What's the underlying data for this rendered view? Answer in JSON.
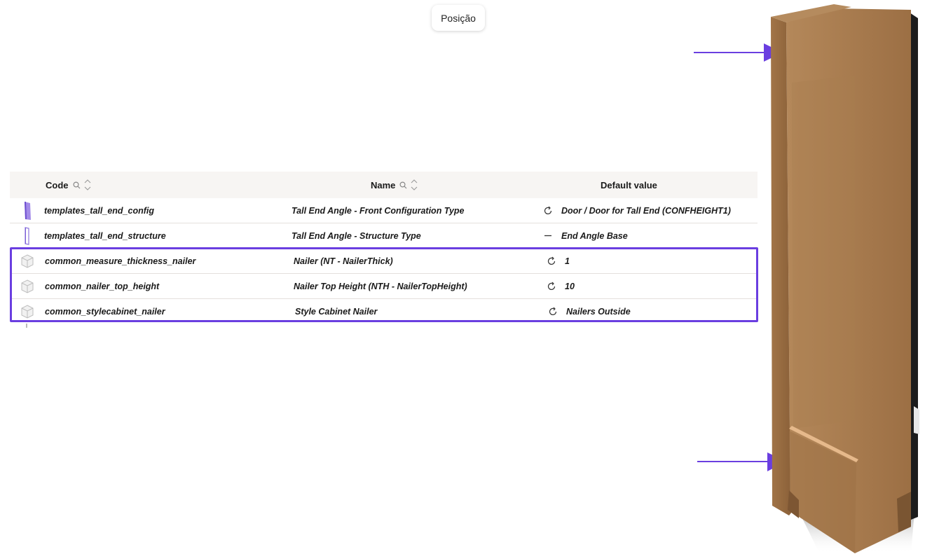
{
  "toolbar": {
    "position_label": "Posição"
  },
  "table": {
    "headers": {
      "code": "Code",
      "name": "Name",
      "default_value": "Default value"
    },
    "rows": [
      {
        "code": "templates_tall_end_config",
        "name": "Tall End Angle - Front Configuration Type",
        "value_icon": "reset-icon",
        "default_value": "Door / Door for Tall End (CONFHEIGHT1)"
      },
      {
        "code": "templates_tall_end_structure",
        "name": "Tall End Angle - Structure Type",
        "value_icon": "dash-icon",
        "default_value": "End Angle Base"
      },
      {
        "code": "common_measure_thickness_nailer",
        "name": "Nailer (NT - NailerThick)",
        "value_icon": "reset-icon",
        "default_value": "1"
      },
      {
        "code": "common_nailer_top_height",
        "name": "Nailer Top Height (NTH - NailerTopHeight)",
        "value_icon": "reset-icon",
        "default_value": "10"
      },
      {
        "code": "common_stylecabinet_nailer",
        "name": "Style Cabinet Nailer",
        "value_icon": "reset-icon",
        "default_value": "Nailers Outside"
      }
    ]
  },
  "colors": {
    "highlight": "#6a3ee0",
    "arrow": "#6a3ee0",
    "wood": "#a97a4d",
    "header_bg": "#f7f5f3"
  }
}
